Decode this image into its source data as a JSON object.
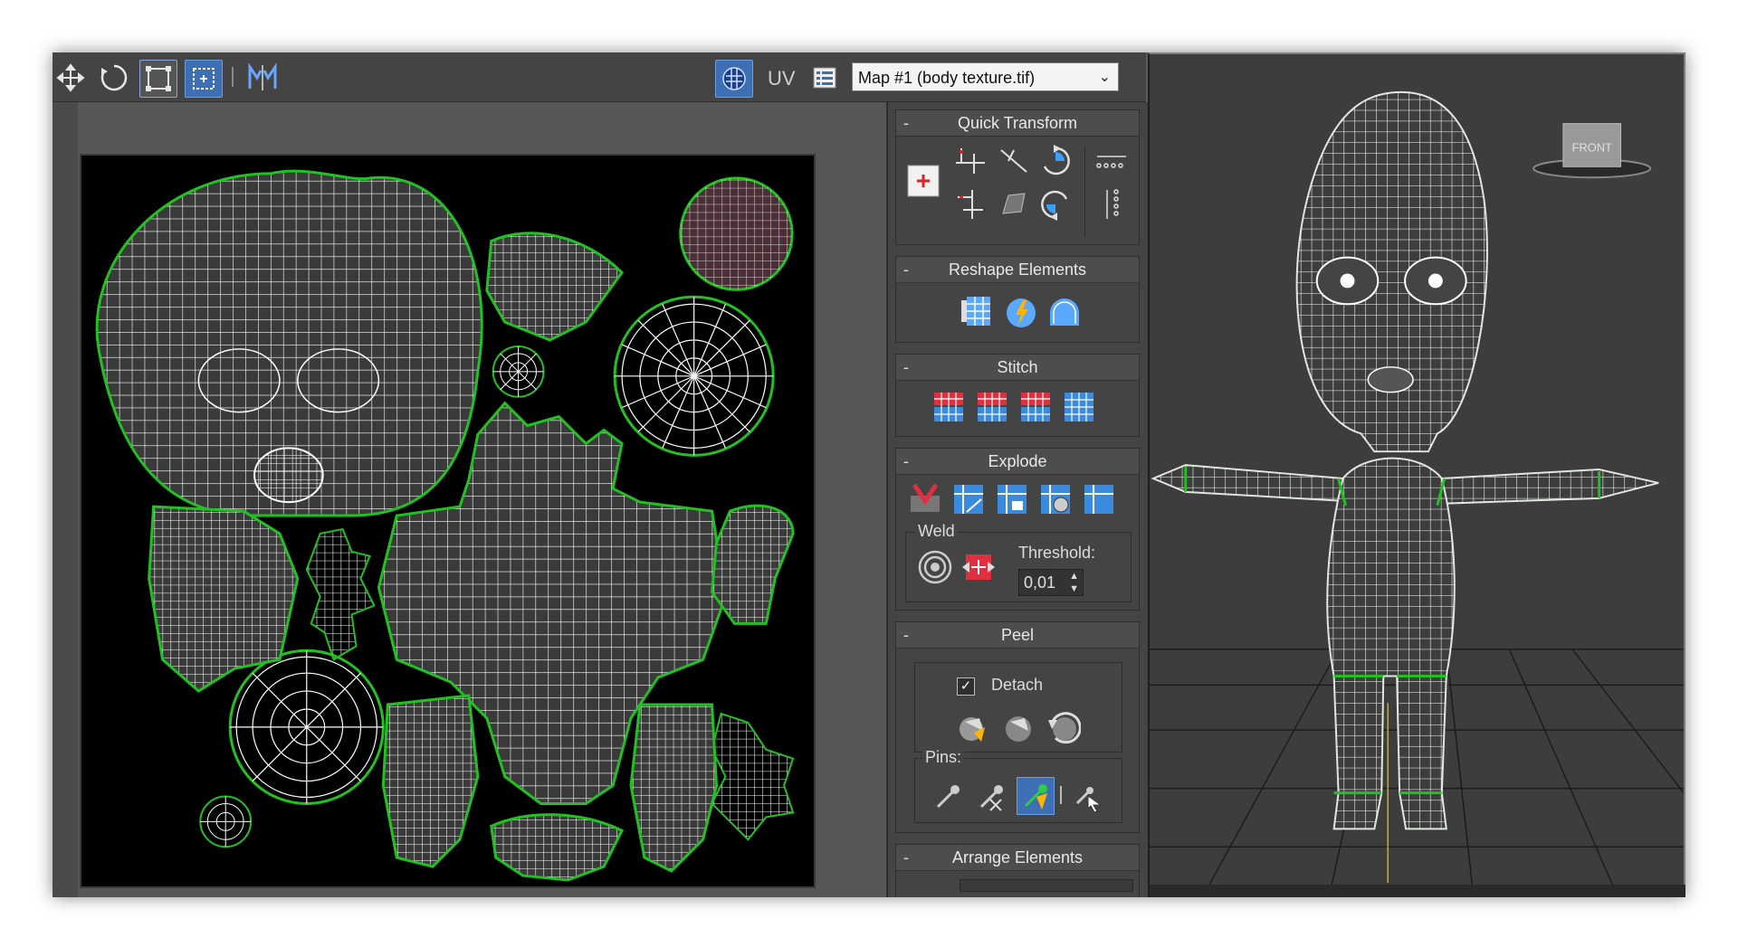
{
  "toolbar": {
    "tools": [
      {
        "icon": "move-icon"
      },
      {
        "icon": "rotate-icon"
      },
      {
        "icon": "scale-icon"
      },
      {
        "icon": "freeform-icon",
        "active": true
      },
      {
        "icon": "mirror-icon"
      }
    ],
    "checker_icon": "checker-map-icon",
    "uv_label": "UV",
    "list_icon": "texture-list-icon",
    "map_selected": "Map #1 (body texture.tif)"
  },
  "rollouts": {
    "quick_transform": {
      "title": "Quick Transform",
      "collapse": "-"
    },
    "reshape": {
      "title": "Reshape Elements",
      "collapse": "-"
    },
    "stitch": {
      "title": "Stitch",
      "collapse": "-"
    },
    "explode": {
      "title": "Explode",
      "collapse": "-",
      "weld_label": "Weld",
      "threshold_label": "Threshold:",
      "threshold_value": "0,01"
    },
    "peel": {
      "title": "Peel",
      "collapse": "-",
      "detach_label": "Detach",
      "detach_checked": true,
      "pins_label": "Pins:"
    },
    "arrange": {
      "title": "Arrange Elements",
      "collapse": "-"
    }
  },
  "viewport": {
    "viewcube_label": "FRONT"
  },
  "colors": {
    "accent": "#3d6fb5",
    "seam": "#22c122",
    "wire": "#ffffff",
    "bg": "#444444"
  }
}
